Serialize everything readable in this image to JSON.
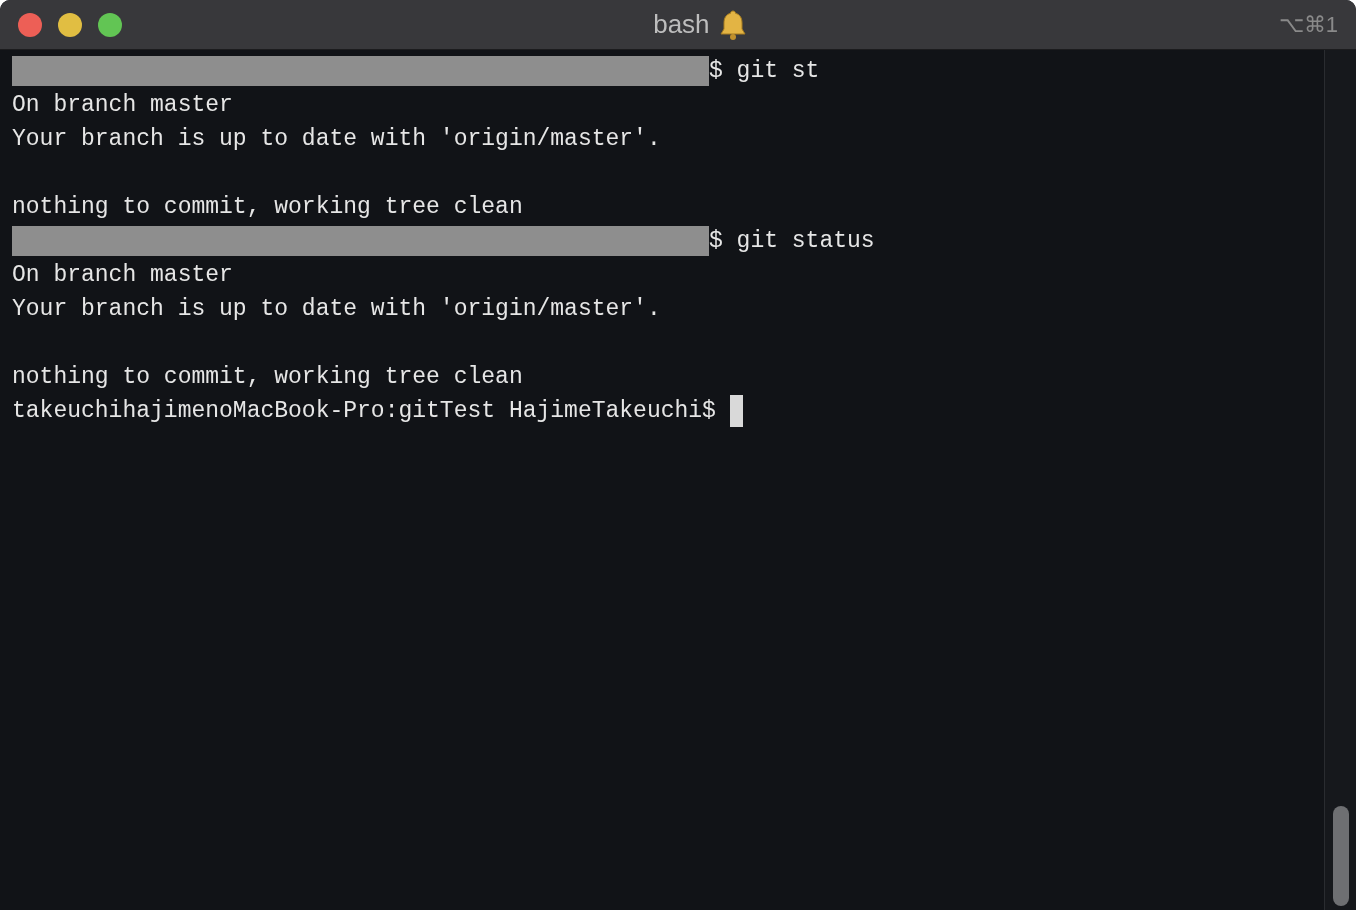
{
  "window": {
    "title": "bash",
    "shortcut": "⌥⌘1"
  },
  "lines": [
    {
      "kind": "prompt",
      "text": "$ git st"
    },
    {
      "kind": "output",
      "text": "On branch master"
    },
    {
      "kind": "output",
      "text": "Your branch is up to date with 'origin/master'."
    },
    {
      "kind": "blank"
    },
    {
      "kind": "output",
      "text": "nothing to commit, working tree clean"
    },
    {
      "kind": "prompt",
      "text": "$ git status"
    },
    {
      "kind": "output",
      "text": "On branch master"
    },
    {
      "kind": "output",
      "text": "Your branch is up to date with 'origin/master'."
    },
    {
      "kind": "blank"
    },
    {
      "kind": "output",
      "text": "nothing to commit, working tree clean"
    },
    {
      "kind": "cursor",
      "text": "takeuchihajimenoMacBook-Pro:gitTest HajimeTakeuchi$"
    }
  ]
}
